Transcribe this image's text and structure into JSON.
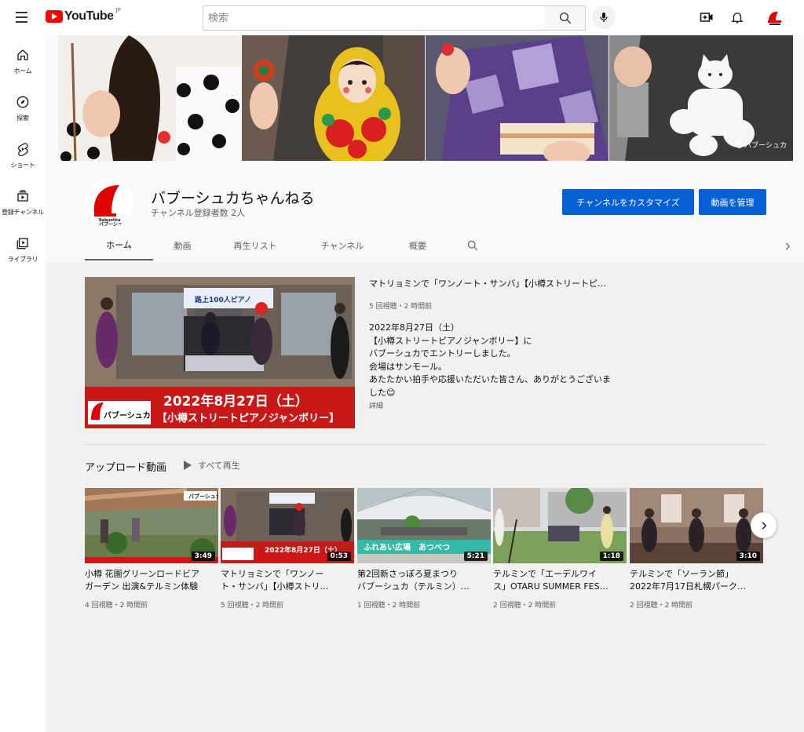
{
  "header": {
    "logo_text": "YouTube",
    "region": "JP",
    "search_placeholder": "検索"
  },
  "sidebar": {
    "items": [
      {
        "label": "ホーム",
        "icon": "home-icon"
      },
      {
        "label": "探索",
        "icon": "compass-icon"
      },
      {
        "label": "ショート",
        "icon": "shorts-icon"
      },
      {
        "label": "登録チャンネル",
        "icon": "subscriptions-icon"
      },
      {
        "label": "ライブラリ",
        "icon": "library-icon"
      }
    ]
  },
  "banner": {
    "watermark": "バブーシュカ"
  },
  "channel": {
    "name": "バブーシュカちゃんねる",
    "subscribers": "チャンネル登録者数 2人",
    "customize_label": "チャンネルをカスタマイズ",
    "manage_label": "動画を管理",
    "avatar_text_top": "Babushka",
    "avatar_text_bottom": "バブーシュカ"
  },
  "tabs": [
    "ホーム",
    "動画",
    "再生リスト",
    "チャンネル",
    "概要"
  ],
  "featured": {
    "title": "マトリョミンで「ワンノート・サンバ」【小樽ストリートピ…",
    "meta": "5 回視聴・2 時間前",
    "description_lines": [
      "2022年8月27日（土）",
      "【小樽ストリートピアノジャンボリー】に",
      "バブーシュカでエントリーしました。",
      "会場はサンモール。",
      "あたたかい拍手や応援いただいた皆さん、ありがとうございま",
      "した😊"
    ],
    "more_label": "詳細",
    "overlay_sign": "路上100人ピアノ",
    "overlay_date": "2022年8月27日（土）",
    "overlay_event": "【小樽ストリートピアノジャンボリー】",
    "overlay_logo": "バブーシュカ"
  },
  "shelf": {
    "title": "アップロード動画",
    "play_all_label": "すべて再生"
  },
  "videos": [
    {
      "title_line1": "小樽 花園グリーンロードビア",
      "title_line2": "ガーデン 出演&テルミン体験",
      "duration": "3:49",
      "meta": "4 回視聴・2 時間前",
      "overlay": "バブーシュカ"
    },
    {
      "title_line1": "マトリョミンで「ワンノー",
      "title_line2": "ト・サンバ」【小樽ストリ…",
      "duration": "0:53",
      "meta": "5 回視聴・2 時間前",
      "overlay": "2022年8月27日（土）"
    },
    {
      "title_line1": "第2回新さっぽろ夏まつり",
      "title_line2": "バブーシュカ（テルミン）…",
      "duration": "5:21",
      "meta": "1 回視聴・2 時間前",
      "overlay": "ふれあい広場　あつべつ"
    },
    {
      "title_line1": "テルミンで「エーデルワイ",
      "title_line2": "ス」OTARU SUMMER FES…",
      "duration": "1:18",
      "meta": "2 回視聴・2 時間前",
      "overlay": ""
    },
    {
      "title_line1": "テルミンで「ソーラン節」",
      "title_line2": "2022年7月17日札幌パーク…",
      "duration": "3:10",
      "meta": "2 回視聴・2 時間前",
      "overlay": ""
    }
  ]
}
